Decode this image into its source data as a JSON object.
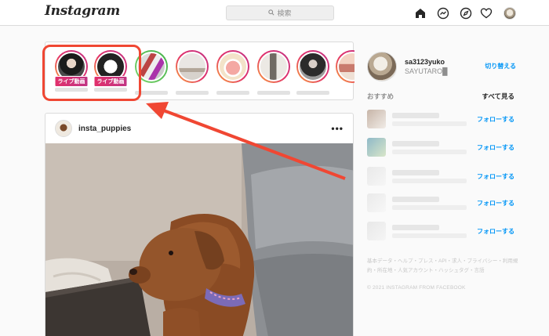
{
  "header": {
    "logo": "Instagram",
    "search_placeholder": "検索",
    "icons": [
      "home-icon",
      "direct-message-icon",
      "explore-icon",
      "heart-icon",
      "profile-avatar"
    ]
  },
  "stories": {
    "items": [
      {
        "badge": "ライブ動画"
      },
      {
        "badge": "ライブ動画"
      },
      {
        "badge": ""
      },
      {
        "badge": ""
      },
      {
        "badge": ""
      },
      {
        "badge": ""
      },
      {
        "badge": ""
      },
      {
        "badge": ""
      }
    ]
  },
  "post": {
    "username": "insta_puppies",
    "more_label": "•••"
  },
  "sidebar": {
    "username": "sa3123yuko",
    "display_name": "SAYUTARO█",
    "switch_label": "切り替える",
    "recommended_title": "おすすめ",
    "see_all_label": "すべて見る",
    "follow_label": "フォローする",
    "footer_links": "基本データ・ヘルプ・プレス・API・求人・プライバシー・利用規約・所在地・人気アカウント・ハッシュタグ・言語",
    "copyright": "© 2021 INSTAGRAM FROM FACEBOOK"
  },
  "colors": {
    "accent": "#0095f6",
    "highlight": "#f04733",
    "live": "#e1306c"
  }
}
